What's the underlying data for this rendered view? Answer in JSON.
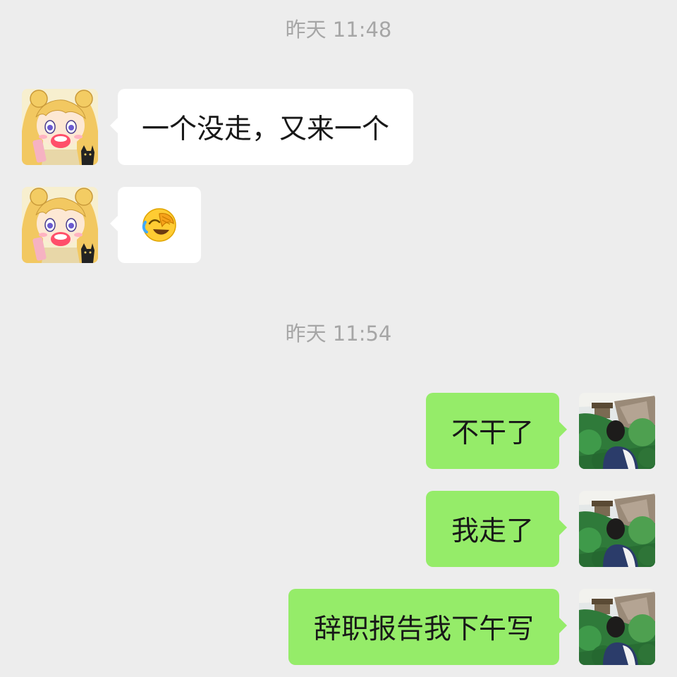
{
  "chat": {
    "timestamps": [
      "昨天 11:48",
      "昨天 11:54"
    ],
    "messages": [
      {
        "direction": "incoming",
        "type": "text",
        "text": "一个没走，又来一个"
      },
      {
        "direction": "incoming",
        "type": "emoji",
        "emoji": "face-with-tears-of-joy-covering-face-icon"
      },
      {
        "direction": "outgoing",
        "type": "text",
        "text": "不干了"
      },
      {
        "direction": "outgoing",
        "type": "text",
        "text": "我走了"
      },
      {
        "direction": "outgoing",
        "type": "text",
        "text": "辞职报告我下午写"
      }
    ]
  },
  "colors": {
    "background": "#ededed",
    "incoming_bubble": "#ffffff",
    "outgoing_bubble": "#95ec69",
    "timestamp_text": "#a6a6a6",
    "message_text": "#181818"
  }
}
